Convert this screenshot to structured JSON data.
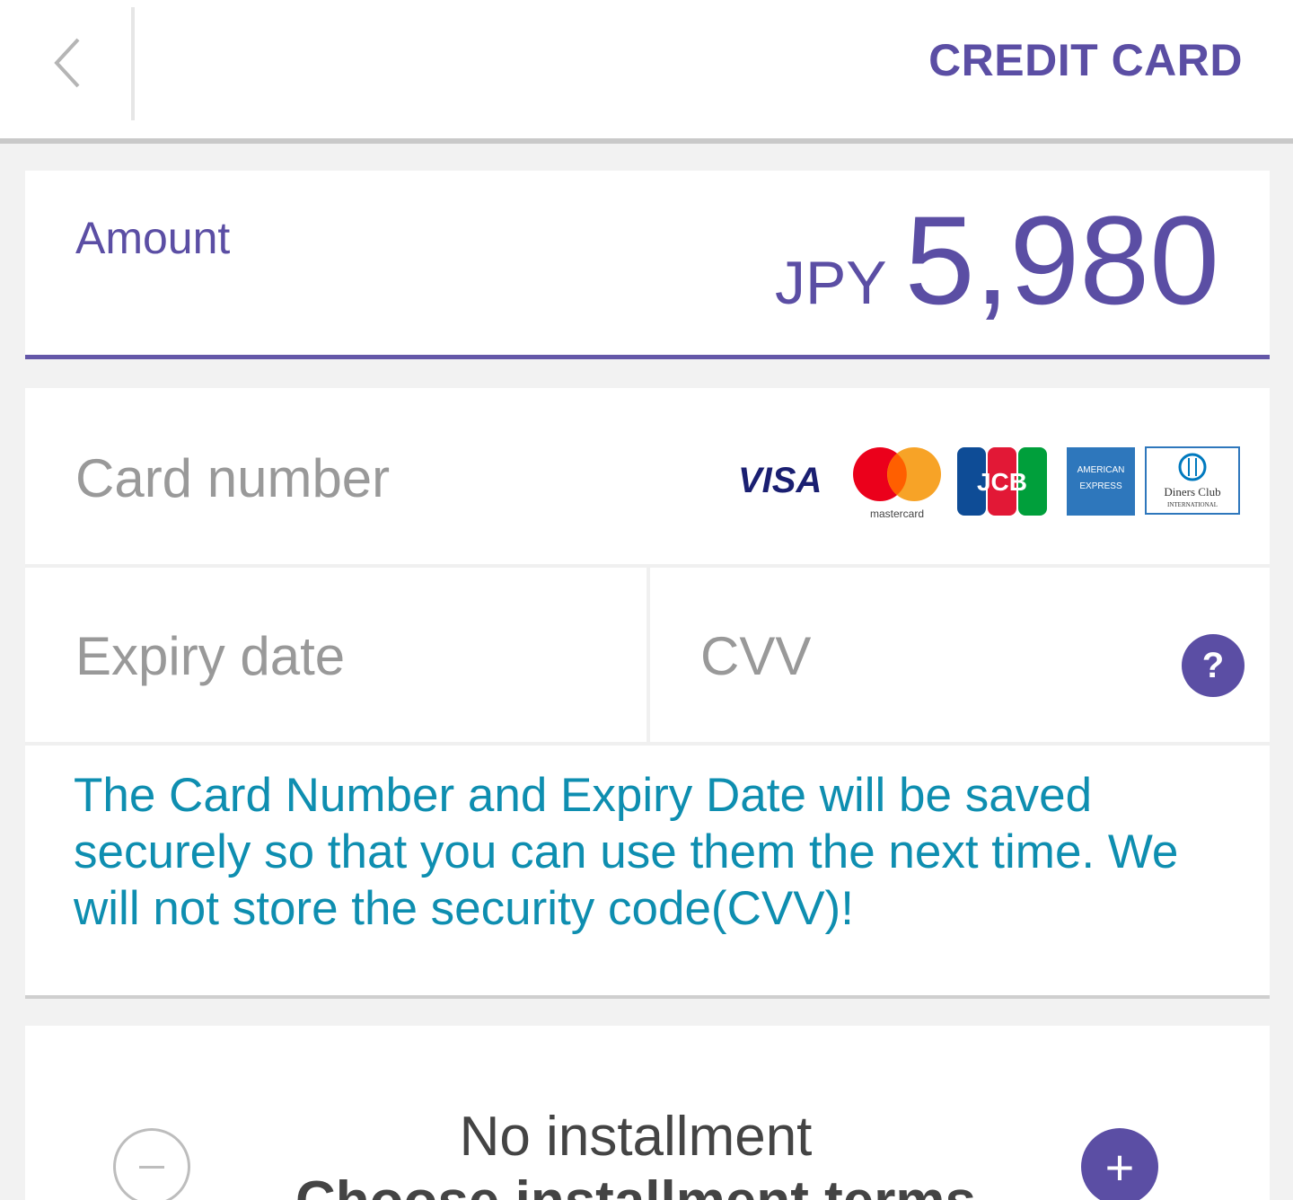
{
  "header": {
    "title": "CREDIT CARD",
    "back_icon": "chevron-left-icon"
  },
  "amount": {
    "label": "Amount",
    "currency": "JPY",
    "value": "5,980"
  },
  "form": {
    "card_number_placeholder": "Card number",
    "expiry_placeholder": "Expiry date",
    "cvv_placeholder": "CVV",
    "help_label": "?",
    "brands": {
      "visa": "VISA",
      "mastercard": "mastercard",
      "jcb": "JCB",
      "amex_line1": "AMERICAN",
      "amex_line2": "EXPRESS",
      "diners_line1": "Diners Club",
      "diners_line2": "INTERNATIONAL"
    },
    "info": "The Card Number and Expiry Date will be saved securely so that you can use them the next time. We will not store the security code(CVV)!"
  },
  "installment": {
    "title": "No installment",
    "subtitle": "Choose installment terms",
    "minus_icon": "minus-circle-icon",
    "plus_label": "+"
  },
  "colors": {
    "accent": "#5b4ea4",
    "info_text": "#0e8eb0",
    "placeholder": "#999999"
  }
}
